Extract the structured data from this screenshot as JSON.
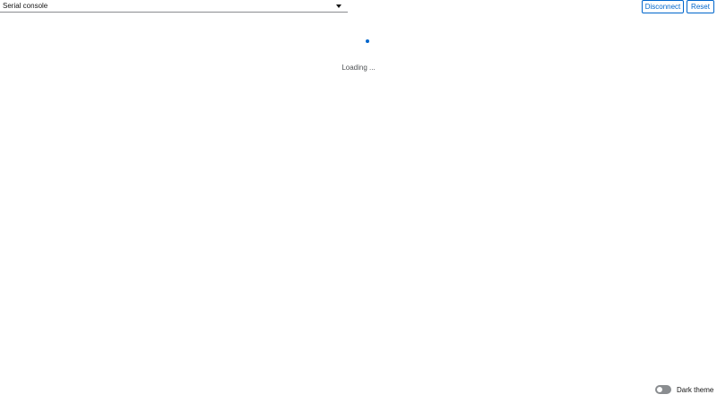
{
  "console_selector": {
    "selected": "Serial console",
    "icon": "caret-down-icon"
  },
  "toolbar": {
    "disconnect_label": "Disconnect",
    "reset_label": "Reset"
  },
  "status": {
    "loading_text": "Loading ..."
  },
  "theme_toggle": {
    "label": "Dark theme",
    "enabled": false
  },
  "colors": {
    "accent": "#0066cc",
    "toggle_off": "#8a8d90",
    "text": "#151515"
  }
}
